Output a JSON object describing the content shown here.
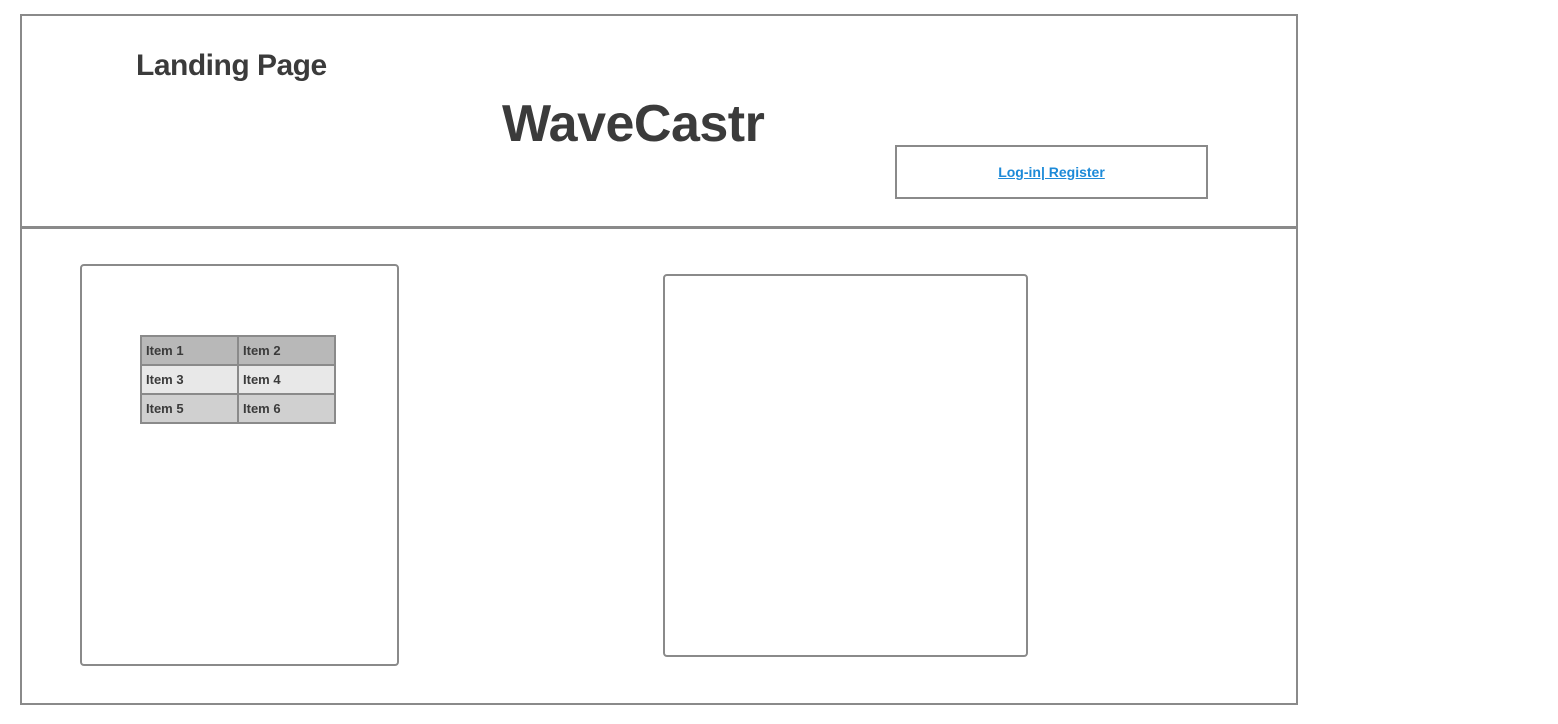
{
  "header": {
    "page_label": "Landing Page",
    "brand_title": "WaveCastr",
    "auth_link": "Log-in| Register"
  },
  "grid": {
    "rows": [
      [
        "Item 1",
        "Item 2"
      ],
      [
        "Item 3",
        "Item 4"
      ],
      [
        "Item 5",
        "Item 6"
      ]
    ]
  },
  "colors": {
    "border": "#8a8a8a",
    "text": "#3b3b3b",
    "link": "#1c8ad8",
    "row_dark": "#b8b8b8",
    "row_light": "#e8e8e8",
    "row_mid": "#d0d0d0"
  }
}
